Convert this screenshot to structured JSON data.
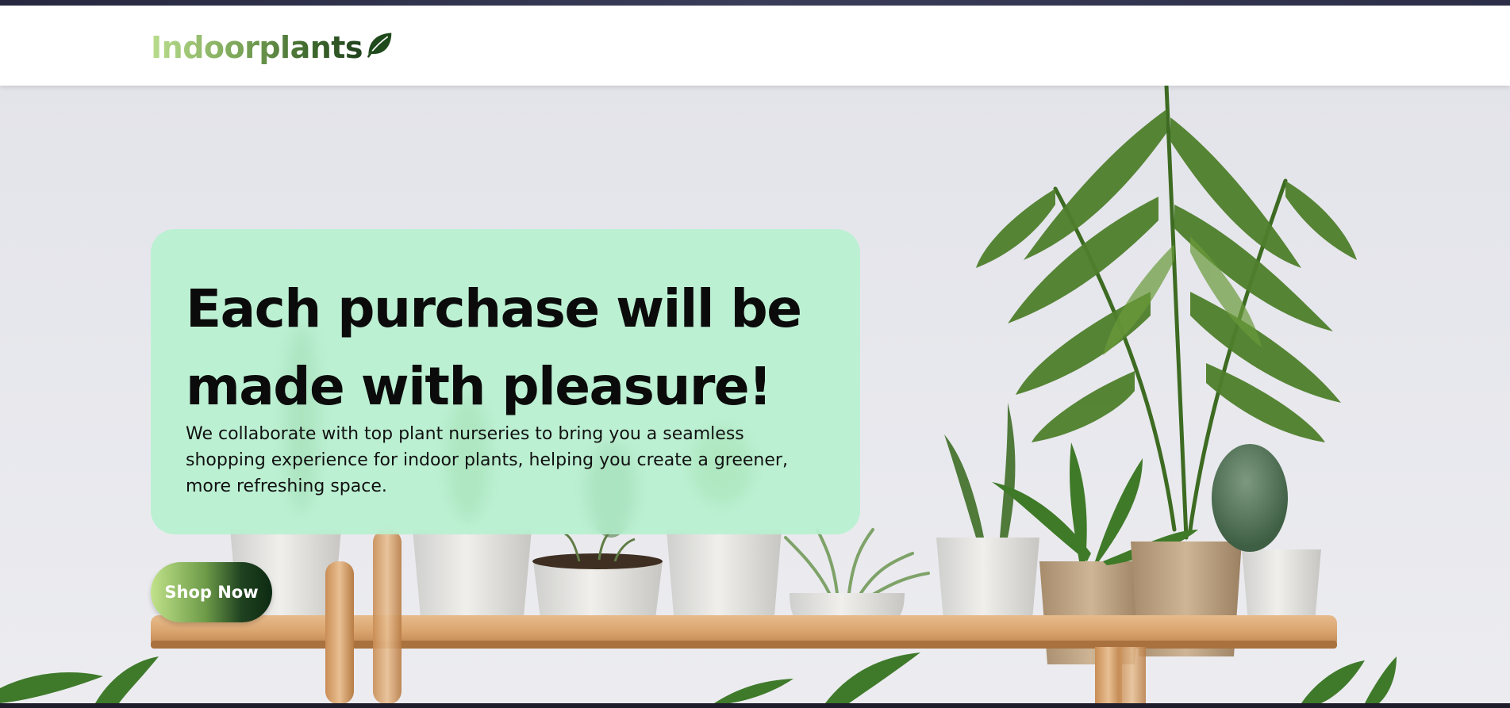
{
  "brand": {
    "name": "Indoorplants"
  },
  "hero": {
    "title": "Each purchase will be made with pleasure!",
    "description": "We collaborate with top plant nurseries to bring you a seamless shopping experience for indoor plants, helping you create a greener, more refreshing space.",
    "cta_label": "Shop Now"
  },
  "colors": {
    "card_bg": "#b2f2cd",
    "brand_light": "#b9dd8d",
    "brand_dark": "#21421d",
    "button_dark": "#0d2a12"
  },
  "icons": {
    "logo": "leaf-icon"
  }
}
